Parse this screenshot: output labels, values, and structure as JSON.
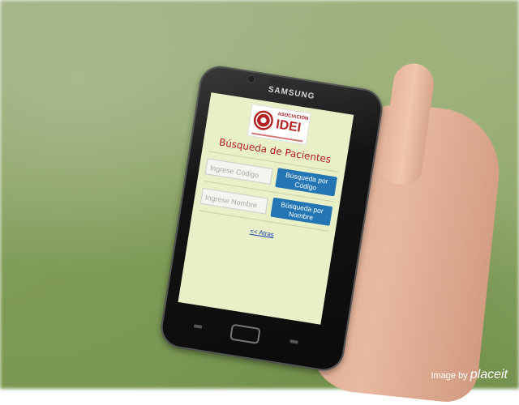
{
  "phone": {
    "brand": "SAMSUNG"
  },
  "app": {
    "logo": {
      "small_text": "ASOCIACIÓN",
      "big_text": "IDEI"
    },
    "title": "Búsqueda de Pacientes",
    "code_input": {
      "placeholder": "Ingrese Código",
      "button": "Búsqueda por Código"
    },
    "name_input": {
      "placeholder": "Ingrese Nombre",
      "button": "Búsqueda por Nombre"
    },
    "back_link": "<< Atras"
  },
  "watermark": {
    "prefix": "Image by",
    "brand": "placeit"
  },
  "colors": {
    "title": "#b21d1d",
    "button": "#2375b3",
    "screen_bg": "#e9efc7",
    "link": "#1a3fb0"
  }
}
